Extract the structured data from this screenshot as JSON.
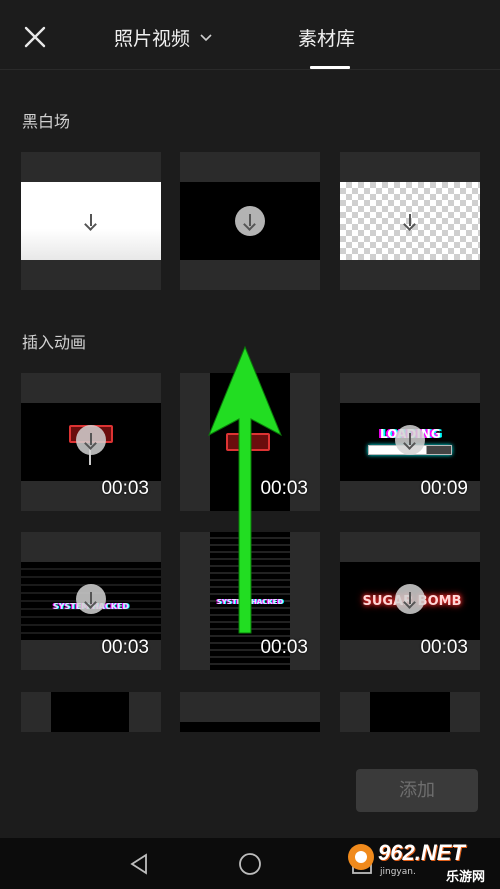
{
  "header": {
    "close_icon": "close-icon",
    "tab_photos": "照片视频",
    "tab_library": "素材库",
    "active_tab": "素材库"
  },
  "sections": [
    {
      "title": "黑白场",
      "items": [
        {
          "kind": "white"
        },
        {
          "kind": "black"
        },
        {
          "kind": "transparent"
        }
      ]
    },
    {
      "title": "插入动画",
      "items": [
        {
          "kind": "battery",
          "duration": "00:03"
        },
        {
          "kind": "battery",
          "duration": "00:03"
        },
        {
          "kind": "loading",
          "label": "LOADING",
          "duration": "00:09"
        },
        {
          "kind": "glitch",
          "label": "SYSTEM HACKED",
          "duration": "00:03"
        },
        {
          "kind": "glitch",
          "label": "SYSTEM HACKED",
          "duration": "00:03"
        },
        {
          "kind": "neon",
          "label": "SUGAR BOMB",
          "duration": "00:03"
        }
      ]
    }
  ],
  "footer": {
    "add_label": "添加"
  },
  "navbar": {
    "icons": [
      "back-triangle-icon",
      "home-circle-icon",
      "recents-square-icon"
    ]
  },
  "watermark": {
    "logo_text": "962.NET",
    "domain_text": "jingyan.",
    "site_name": "乐游网"
  },
  "colors": {
    "background": "#1c1c1c",
    "tile": "#2b2b2b",
    "add_button": "#3a3a3a",
    "annotation_arrow": "#22dd22"
  }
}
